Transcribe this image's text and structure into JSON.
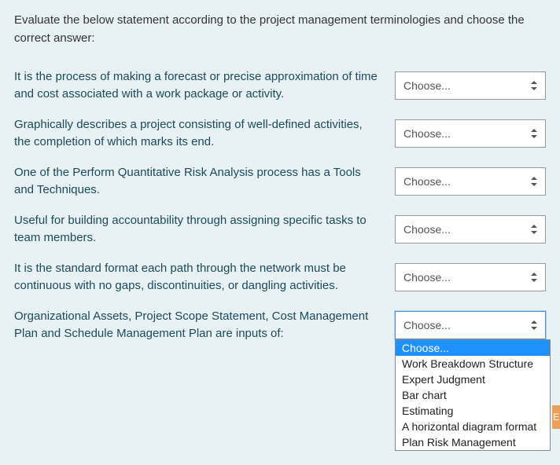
{
  "instruction": "Evaluate the below statement according to the project management terminologies and choose the correct answer:",
  "questions": [
    {
      "text": "It is the process of making a forecast or precise approximation of time and cost associated with a work package or activity.",
      "selected": "Choose..."
    },
    {
      "text": "Graphically describes a project consisting of well-defined activities, the completion of which marks its end.",
      "selected": "Choose..."
    },
    {
      "text": "One of the Perform Quantitative Risk Analysis process has a Tools and Techniques.",
      "selected": "Choose..."
    },
    {
      "text": "Useful for building accountability through assigning specific tasks to team members.",
      "selected": "Choose..."
    },
    {
      "text": "It is the standard format each path through the network must be continuous with no gaps, discontinuities, or dangling activities.",
      "selected": "Choose..."
    },
    {
      "text": "Organizational Assets, Project Scope Statement, Cost Management Plan and Schedule Management Plan are inputs of:",
      "selected": "Choose..."
    }
  ],
  "dropdown_options": [
    "Choose...",
    "Work Breakdown Structure",
    "Expert Judgment",
    "Bar chart",
    "Estimating",
    "A horizontal diagram format",
    "Plan Risk Management"
  ],
  "badge_fragment": "E"
}
